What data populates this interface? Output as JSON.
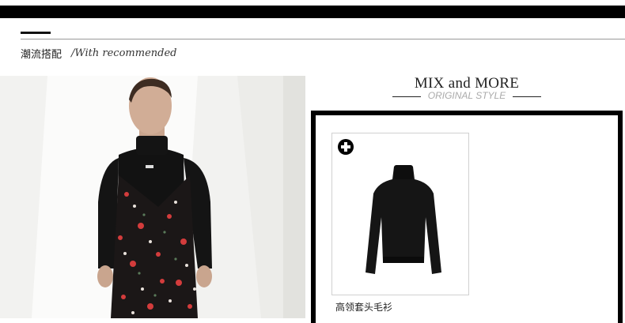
{
  "section": {
    "title": "潮流搭配",
    "subtitle": "/With recommended"
  },
  "mix": {
    "heading": "MIX and MORE",
    "subheading": "ORIGINAL STYLE"
  },
  "product": {
    "name": "高领套头毛衫",
    "add_icon": "plus-circle-icon"
  },
  "colors": {
    "accent": "#000000",
    "text": "#222222",
    "muted": "#aaaaaa",
    "border": "#d0d0d0"
  }
}
